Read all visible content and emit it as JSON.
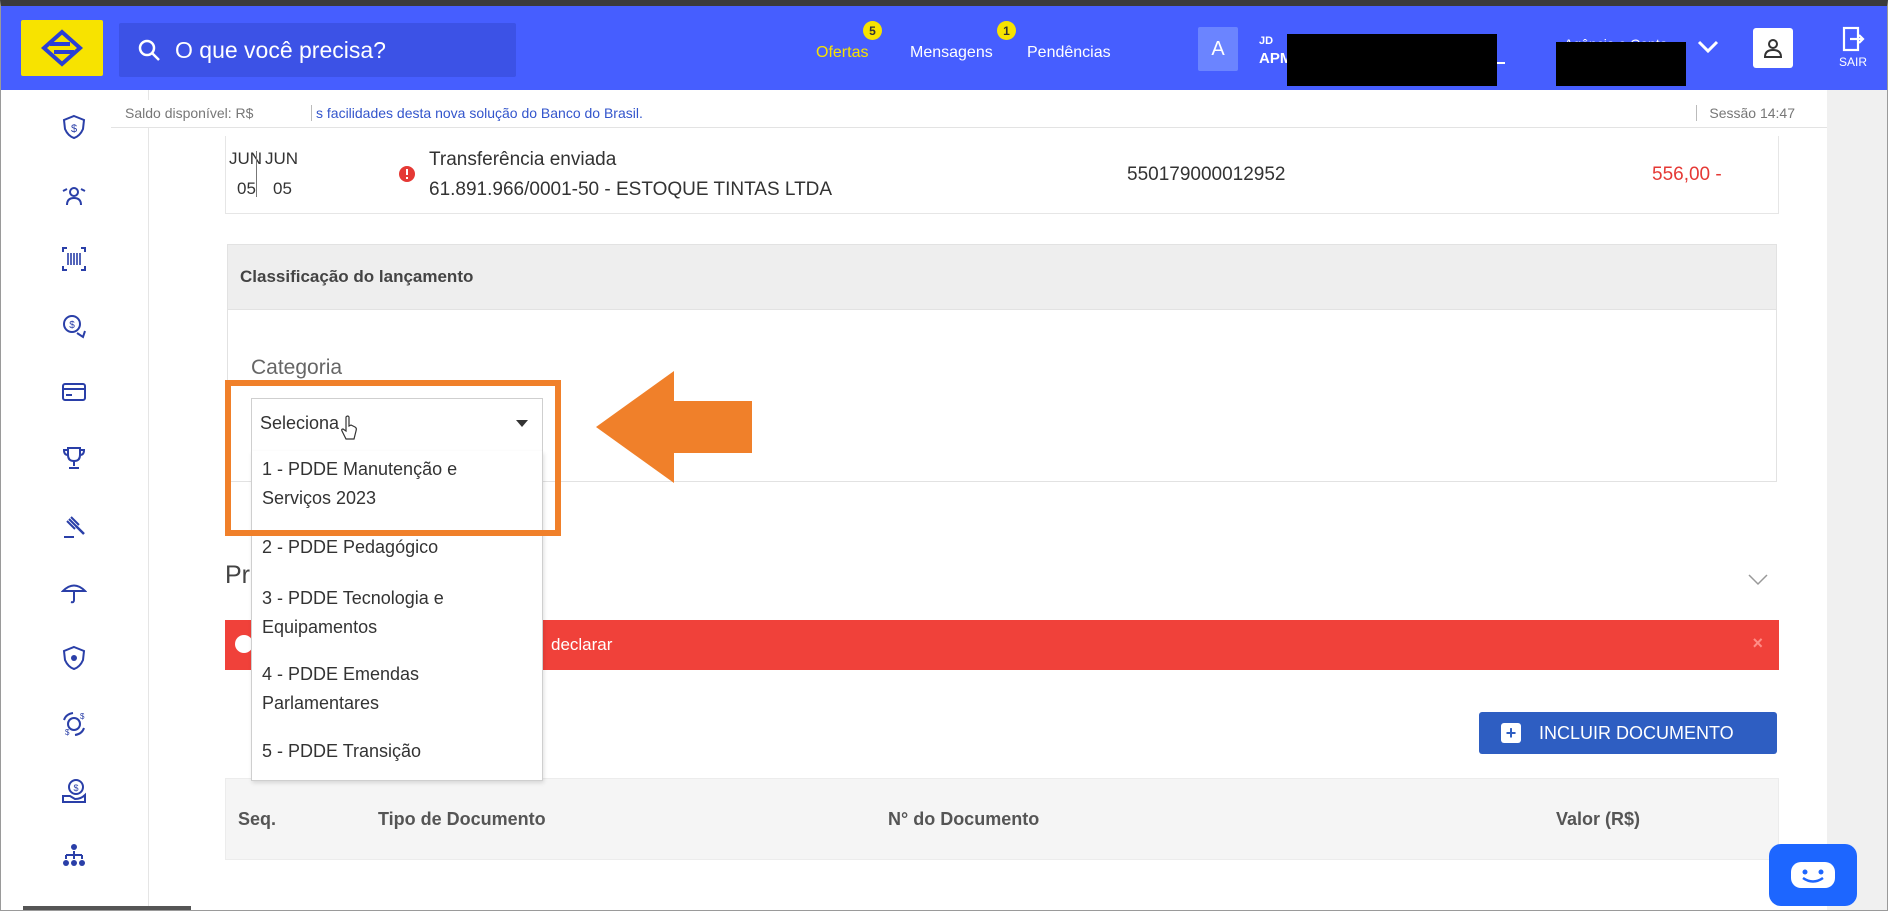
{
  "header": {
    "search_placeholder": "O que você precisa?",
    "nav": [
      {
        "label": "Ofertas",
        "badge": "5"
      },
      {
        "label": "Mensagens",
        "badge": "1"
      },
      {
        "label": "Pendências"
      }
    ],
    "avatar_letter": "A",
    "user_small": "JD",
    "user_main": "APM",
    "agencia_label": "Agência e Conta",
    "exit_label": "SAIR",
    "colors": {
      "brand_blue": "#465EFF",
      "brand_yellow": "#F7E300"
    }
  },
  "info_strip": {
    "saldo": "Saldo disponível: R$",
    "news": "s facilidades desta nova solução do Banco do Brasil.",
    "sessao": "Sessão 14:47"
  },
  "sidebar_icons": [
    "shield-dollar-icon",
    "transfer-icon",
    "barcode-icon",
    "investment-icon",
    "card-icon",
    "trophy-icon",
    "auction-icon",
    "umbrella-icon",
    "security-icon",
    "exchange-icon",
    "loan-icon",
    "org-chart-icon"
  ],
  "transaction": {
    "month1": "JUN",
    "day1": "05",
    "month2": "JUN",
    "day2": "05",
    "title": "Transferência enviada",
    "subtitle": "61.891.966/0001-50 - ESTOQUE TINTAS LTDA",
    "id": "550179000012952",
    "value": "556,00 -"
  },
  "classification": {
    "header": "Classificação do lançamento",
    "category_label": "Categoria",
    "select_value": "Seleciona",
    "options": [
      {
        "line1": "1 - PDDE Manutenção e",
        "line2": "Serviços 2023"
      },
      {
        "line1": "2 - PDDE Pedagógico",
        "line2": ""
      },
      {
        "line1": "3 - PDDE Tecnologia e",
        "line2": "Equipamentos"
      },
      {
        "line1": "4 - PDDE Emendas",
        "line2": "Parlamentares"
      },
      {
        "line1": "5 - PDDE Transição",
        "line2": ""
      }
    ]
  },
  "section": {
    "title_fragment": "Pr",
    "alert_text": "declarar",
    "alert_close": "×",
    "add_button": "INCLUIR DOCUMENTO"
  },
  "table": {
    "headers": [
      "Seq.",
      "Tipo de Documento",
      "N° do Documento",
      "Valor (R$)"
    ]
  }
}
